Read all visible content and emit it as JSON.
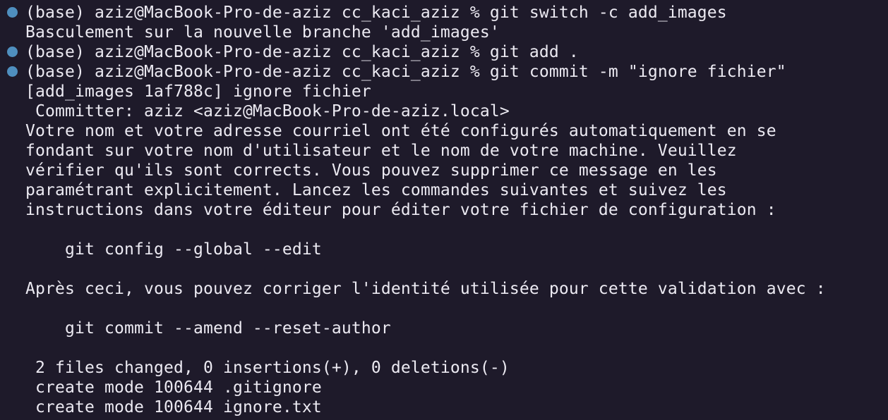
{
  "terminal": {
    "lines": [
      {
        "text": "(base) aziz@MacBook-Pro-de-aziz cc_kaci_aziz % git switch -c add_images",
        "marker": true
      },
      {
        "text": "Basculement sur la nouvelle branche 'add_images'",
        "marker": false
      },
      {
        "text": "(base) aziz@MacBook-Pro-de-aziz cc_kaci_aziz % git add .",
        "marker": true
      },
      {
        "text": "(base) aziz@MacBook-Pro-de-aziz cc_kaci_aziz % git commit -m \"ignore fichier\"",
        "marker": true
      },
      {
        "text": "[add_images 1af788c] ignore fichier",
        "marker": false
      },
      {
        "text": " Committer: aziz <aziz@MacBook-Pro-de-aziz.local>",
        "marker": false
      },
      {
        "text": "Votre nom et votre adresse courriel ont été configurés automatiquement en se",
        "marker": false
      },
      {
        "text": "fondant sur votre nom d'utilisateur et le nom de votre machine. Veuillez",
        "marker": false
      },
      {
        "text": "vérifier qu'ils sont corrects. Vous pouvez supprimer ce message en les",
        "marker": false
      },
      {
        "text": "paramétrant explicitement. Lancez les commandes suivantes et suivez les",
        "marker": false
      },
      {
        "text": "instructions dans votre éditeur pour éditer votre fichier de configuration :",
        "marker": false
      },
      {
        "text": "",
        "marker": false
      },
      {
        "text": "    git config --global --edit",
        "marker": false
      },
      {
        "text": "",
        "marker": false
      },
      {
        "text": "Après ceci, vous pouvez corriger l'identité utilisée pour cette validation avec :",
        "marker": false
      },
      {
        "text": "",
        "marker": false
      },
      {
        "text": "    git commit --amend --reset-author",
        "marker": false
      },
      {
        "text": "",
        "marker": false
      },
      {
        "text": " 2 files changed, 0 insertions(+), 0 deletions(-)",
        "marker": false
      },
      {
        "text": " create mode 100644 .gitignore",
        "marker": false
      },
      {
        "text": " create mode 100644 ignore.txt",
        "marker": false
      }
    ],
    "colors": {
      "background": "#1e1a2a",
      "text": "#eceaf2",
      "prompt_marker": "#4f8fbf"
    }
  }
}
